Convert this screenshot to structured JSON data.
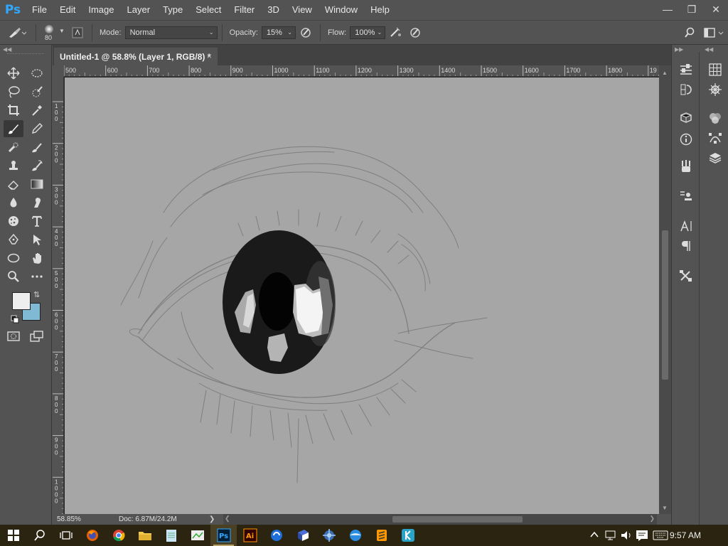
{
  "app": {
    "logo": "Ps",
    "window_controls": [
      "minimize",
      "restore",
      "close"
    ]
  },
  "menu": {
    "items": [
      "File",
      "Edit",
      "Image",
      "Layer",
      "Type",
      "Select",
      "Filter",
      "3D",
      "View",
      "Window",
      "Help"
    ]
  },
  "options": {
    "brush_size": "80",
    "mode_label": "Mode:",
    "mode_value": "Normal",
    "opacity_label": "Opacity:",
    "opacity_value": "15%",
    "flow_label": "Flow:",
    "flow_value": "100%"
  },
  "document": {
    "tab_title": "Untitled-1 @ 58.8% (Layer 1, RGB/8) *",
    "close": "×"
  },
  "ruler": {
    "h_ticks": [
      "500",
      "600",
      "700",
      "800",
      "900",
      "1000",
      "1100",
      "1200",
      "1300",
      "1400",
      "1500",
      "1600",
      "1700",
      "1800",
      "19"
    ],
    "v_ticks": [
      [
        "1",
        "0",
        "0"
      ],
      [
        "2",
        "0",
        "0"
      ],
      [
        "3",
        "0",
        "0"
      ],
      [
        "4",
        "0",
        "0"
      ],
      [
        "5",
        "0",
        "0"
      ],
      [
        "6",
        "0",
        "0"
      ],
      [
        "7",
        "0",
        "0"
      ],
      [
        "8",
        "0",
        "0"
      ],
      [
        "9",
        "0",
        "0"
      ],
      [
        "1",
        "0",
        "0",
        "0"
      ]
    ]
  },
  "status": {
    "zoom": "58.85%",
    "doc_info": "Doc: 6.87M/24.2M"
  },
  "colors": {
    "foreground": "#eeeeee",
    "background": "#7fb9d3",
    "canvas": "#a6a6a6",
    "iris": "#111111",
    "highlight": "#f4f4f4",
    "taskbar": "#2a2411",
    "accent_blue": "#31a8ff"
  },
  "tools": [
    "move-tool",
    "marquee-tool",
    "lasso-tool",
    "quick-selection-tool",
    "crop-tool",
    "eyedropper-tool",
    "brush-tool",
    "pencil-tool",
    "healing-tool",
    "history-brush-tool",
    "clone-stamp-tool",
    "smudge-tool",
    "eraser-tool",
    "gradient-tool",
    "blur-tool",
    "dodge-tool",
    "sponge-tool",
    "type-tool",
    "pen-tool",
    "path-selection-tool",
    "ellipse-tool",
    "hand-tool",
    "zoom-tool",
    "more-tools"
  ],
  "panels": [
    "properties",
    "adjustments",
    "3d",
    "info",
    "brushes",
    "clone-source",
    "character",
    "paragraph",
    "tool-presets",
    "swatches",
    "navigator",
    "color",
    "paths",
    "layers"
  ],
  "taskbar": {
    "apps": [
      "start",
      "search",
      "task-view",
      "firefox",
      "chrome",
      "file-explorer",
      "notepad",
      "paint",
      "photoshop",
      "illustrator",
      "app-blue",
      "app-book",
      "app-gear",
      "app-globe",
      "app-sublime",
      "app-k"
    ],
    "clock": "9:57 AM"
  }
}
